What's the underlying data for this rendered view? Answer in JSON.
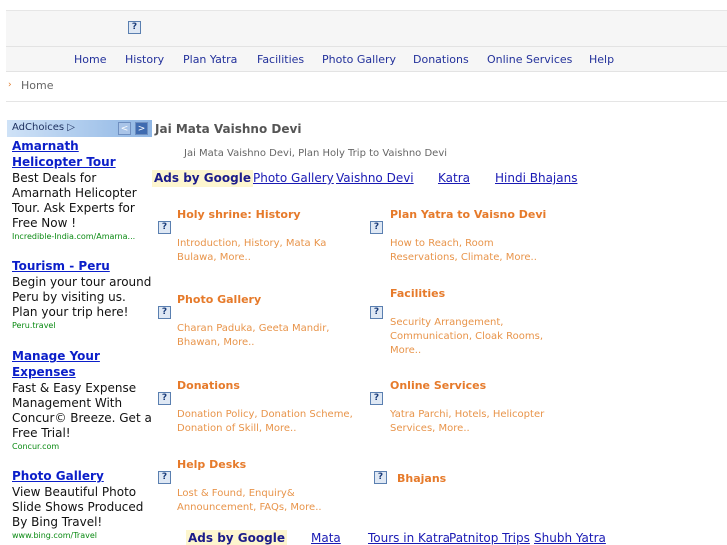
{
  "header": {
    "logo_icon": "?"
  },
  "nav": {
    "items": [
      "Home",
      "History",
      "Plan Yatra",
      "Facilities",
      "Photo Gallery",
      "Donations",
      "Online Services",
      "Help"
    ]
  },
  "breadcrumb": {
    "home": "Home"
  },
  "sidebar_ads": {
    "adchoices": "AdChoices ▷",
    "prev": "<",
    "next": ">",
    "ads": [
      {
        "title": "Amarnath Helicopter Tour",
        "desc": "Best Deals for Amarnath Helicopter Tour. Ask Experts for Free Now !",
        "url": "Incredible-India.com/Amarna..."
      },
      {
        "title": "Tourism - Peru",
        "desc": "Begin your tour around Peru by visiting us. Plan your trip here!",
        "url": "Peru.travel"
      },
      {
        "title": "Manage Your Expenses",
        "desc": "Fast & Easy Expense Management With Concur© Breeze. Get a Free Trial!",
        "url": "Concur.com"
      },
      {
        "title": "Photo Gallery",
        "desc": "View Beautiful Photo Slide Shows Produced By Bing Travel!",
        "url": "www.bing.com/Travel"
      }
    ]
  },
  "main": {
    "title": "Jai Mata Vaishno Devi",
    "subtitle": "Jai Mata Vaishno Devi, Plan Holy Trip to Vaishno Devi",
    "ad_links_top": {
      "label": "Ads by Google",
      "links": [
        "Photo Gallery",
        "Vaishno Devi",
        "Katra",
        "Hindi Bhajans"
      ]
    },
    "ad_links_bottom": {
      "label": "Ads by Google",
      "links": [
        "Mata",
        "Tours in Katra",
        "Patnitop Trips",
        "Shubh Yatra"
      ]
    },
    "sections": [
      {
        "title": "Holy shrine: History",
        "desc": "Introduction, History, Mata Ka Bulawa, More.."
      },
      {
        "title": "Plan Yatra to Vaisno Devi",
        "desc": "How to Reach, Room Reservations, Climate, More.."
      },
      {
        "title": "Photo Gallery",
        "desc": "Charan Paduka, Geeta Mandir, Bhawan, More.."
      },
      {
        "title": "Facilities",
        "desc": "Security Arrangement, Communication, Cloak Rooms, More.."
      },
      {
        "title": "Donations",
        "desc": "Donation Policy, Donation Scheme, Donation of Skill, More.."
      },
      {
        "title": "Online Services",
        "desc": "Yatra Parchi, Hotels, Helicopter Services, More.."
      },
      {
        "title": "Help Desks",
        "desc": "Lost & Found, Enquiry& Announcement, FAQs, More.."
      },
      {
        "title": "Bhajans",
        "desc": ""
      }
    ],
    "icon_glyph": "?"
  },
  "colors": {
    "nav_link": "#23319b",
    "section_title": "#e67a2a",
    "ad_title": "#0b1ec9",
    "ad_url": "#0a8a12"
  }
}
